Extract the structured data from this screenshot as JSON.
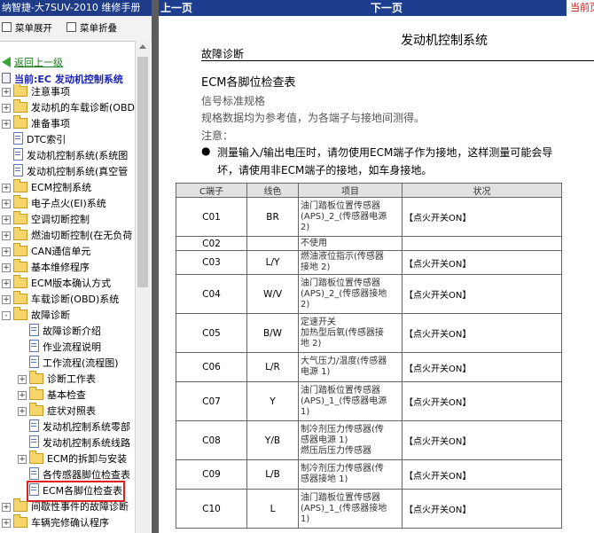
{
  "left": {
    "window_title": "纳智捷-大7SUV-2010 维修手册",
    "toolbar": {
      "expand": "菜单展开",
      "collapse": "菜单折叠"
    },
    "back_link": "返回上一级",
    "current": "当前:EC 发动机控制系统",
    "tree": [
      {
        "label": "注意事项",
        "icon": "folder-icon",
        "level": 0,
        "toggle": "+"
      },
      {
        "label": "发动机的车载诊断(OBD",
        "icon": "folder-icon",
        "level": 0,
        "toggle": "+"
      },
      {
        "label": "准备事项",
        "icon": "folder-icon",
        "level": 0,
        "toggle": "+"
      },
      {
        "label": "DTC索引",
        "icon": "document-icon",
        "level": 0,
        "toggle": ""
      },
      {
        "label": "发动机控制系统(系统图",
        "icon": "document-icon",
        "level": 0,
        "toggle": ""
      },
      {
        "label": "发动机控制系统(真空管",
        "icon": "document-icon",
        "level": 0,
        "toggle": ""
      },
      {
        "label": "ECM控制系统",
        "icon": "folder-icon",
        "level": 0,
        "toggle": "+"
      },
      {
        "label": "电子点火(EI)系统",
        "icon": "folder-icon",
        "level": 0,
        "toggle": "+"
      },
      {
        "label": "空调切断控制",
        "icon": "folder-icon",
        "level": 0,
        "toggle": "+"
      },
      {
        "label": "燃油切断控制(在无负荷",
        "icon": "folder-icon",
        "level": 0,
        "toggle": "+"
      },
      {
        "label": "CAN通信单元",
        "icon": "folder-icon",
        "level": 0,
        "toggle": "+"
      },
      {
        "label": "基本维修程序",
        "icon": "folder-icon",
        "level": 0,
        "toggle": "+"
      },
      {
        "label": "ECM版本确认方式",
        "icon": "folder-icon",
        "level": 0,
        "toggle": "+"
      },
      {
        "label": "车载诊断(OBD)系统",
        "icon": "folder-icon",
        "level": 0,
        "toggle": "+"
      },
      {
        "label": "故障诊断",
        "icon": "folder-open-icon",
        "level": 0,
        "toggle": "-"
      },
      {
        "label": "故障诊断介绍",
        "icon": "document-icon",
        "level": 1,
        "toggle": ""
      },
      {
        "label": "作业流程说明",
        "icon": "document-icon",
        "level": 1,
        "toggle": ""
      },
      {
        "label": "工作流程(流程图)",
        "icon": "document-icon",
        "level": 1,
        "toggle": ""
      },
      {
        "label": "诊断工作表",
        "icon": "folder-icon",
        "level": 1,
        "toggle": "+"
      },
      {
        "label": "基本检查",
        "icon": "folder-icon",
        "level": 1,
        "toggle": "+"
      },
      {
        "label": "症状对照表",
        "icon": "folder-icon",
        "level": 1,
        "toggle": "+"
      },
      {
        "label": "发动机控制系统零部",
        "icon": "document-icon",
        "level": 1,
        "toggle": ""
      },
      {
        "label": "发动机控制系统线路",
        "icon": "document-icon",
        "level": 1,
        "toggle": ""
      },
      {
        "label": "ECM的拆卸与安装",
        "icon": "folder-icon",
        "level": 1,
        "toggle": "+"
      },
      {
        "label": "各传感器脚位检查表",
        "icon": "document-icon",
        "level": 1,
        "toggle": ""
      },
      {
        "label": "ECM各脚位检查表",
        "icon": "document-icon",
        "level": 1,
        "toggle": "",
        "selected": true
      },
      {
        "label": "间歇性事件的故障诊断",
        "icon": "folder-icon",
        "level": 0,
        "toggle": "+"
      },
      {
        "label": "车辆完修确认程序",
        "icon": "folder-icon",
        "level": 0,
        "toggle": "+"
      }
    ]
  },
  "right": {
    "topbar": {
      "prev": "上一页",
      "next": "下一页",
      "current": "当前页"
    },
    "doc_title": "发动机控制系统",
    "section_label": "故障诊断",
    "section_heading": "ECM各脚位检查表",
    "spec_title": "信号标准规格",
    "spec_note": "规格数据均为参考值，为各端子与接地间测得。",
    "note_label": "注意：",
    "note_bullet": "●",
    "note_line1": "测量输入/输出电压时，请勿使用ECM端子作为接地，这样测量可能会导",
    "note_line2": "坏，请使用非ECM端子的接地，如车身接地。",
    "table": {
      "headers": [
        "C端子",
        "线色",
        "项目",
        "状况"
      ],
      "rows": [
        {
          "pin": "C01",
          "color": "BR",
          "item": [
            "油门踏板位置传感器",
            "(APS)_2_(传感器电源",
            "2)"
          ],
          "cond": "【点火开关ON】"
        },
        {
          "pin": "C02",
          "color": "",
          "item": [
            "不使用"
          ],
          "cond": ""
        },
        {
          "pin": "C03",
          "color": "L/Y",
          "item": [
            "燃油液位指示(传感器",
            "接地 2)"
          ],
          "cond": "【点火开关ON】"
        },
        {
          "pin": "C04",
          "color": "W/V",
          "item": [
            "油门踏板位置传感器",
            "(APS)_2_(传感器接地",
            "2)"
          ],
          "cond": "【点火开关ON】"
        },
        {
          "pin": "C05",
          "color": "B/W",
          "item": [
            "定速开关",
            "加热型后氧(传感器接",
            "地 2)"
          ],
          "cond": "【点火开关ON】"
        },
        {
          "pin": "C06",
          "color": "L/R",
          "item": [
            "大气压力/温度(传感器",
            "电源 1)"
          ],
          "cond": "【点火开关ON】"
        },
        {
          "pin": "C07",
          "color": "Y",
          "item": [
            "油门踏板位置传感器",
            "(APS)_1_(传感器电源",
            "1)"
          ],
          "cond": "【点火开关ON】"
        },
        {
          "pin": "C08",
          "color": "Y/B",
          "item": [
            "制冷剂压力传感器(传",
            "感器电源 1)",
            "燃压后压力传感器"
          ],
          "cond": "【点火开关ON】"
        },
        {
          "pin": "C09",
          "color": "L/B",
          "item": [
            "制冷剂压力传感器(传",
            "感器接地 1)"
          ],
          "cond": "【点火开关ON】"
        },
        {
          "pin": "C10",
          "color": "L",
          "item": [
            "油门踏板位置传感器",
            "(APS)_1_(传感器接地",
            "1)"
          ],
          "cond": "【点火开关ON】"
        }
      ]
    }
  }
}
